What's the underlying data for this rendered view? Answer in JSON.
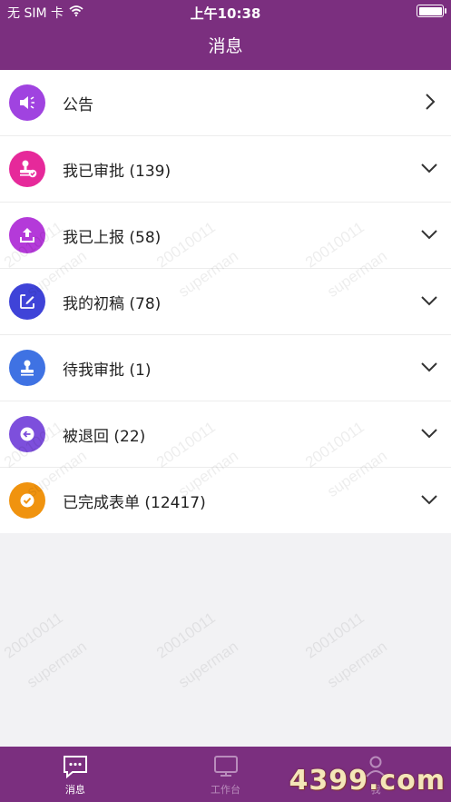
{
  "status_bar": {
    "carrier": "无 SIM 卡",
    "time": "上午10:38"
  },
  "header": {
    "title": "消息"
  },
  "list": [
    {
      "label": "公告",
      "icon": "speaker-icon",
      "color": "#a043e0",
      "chevron": "right"
    },
    {
      "label": "我已审批 (139)",
      "icon": "stamp-approved-icon",
      "color": "#e6299a",
      "chevron": "down"
    },
    {
      "label": "我已上报 (58)",
      "icon": "upload-icon",
      "color": "#b43ad9",
      "chevron": "down"
    },
    {
      "label": "我的初稿 (78)",
      "icon": "edit-draft-icon",
      "color": "#3f43d8",
      "chevron": "down"
    },
    {
      "label": "待我审批 (1)",
      "icon": "stamp-icon",
      "color": "#3f72e3",
      "chevron": "down"
    },
    {
      "label": "被退回 (22)",
      "icon": "return-arrow-icon",
      "color": "#7d4fdc",
      "chevron": "down"
    },
    {
      "label": "已完成表单 (12417)",
      "icon": "check-circle-icon",
      "color": "#f0930f",
      "chevron": "down"
    }
  ],
  "watermark": {
    "line1": "20010011",
    "line2": "superman"
  },
  "tabs": [
    {
      "label": "消息",
      "icon": "chat-icon",
      "active": true
    },
    {
      "label": "工作台",
      "icon": "monitor-icon",
      "active": false
    },
    {
      "label": "我",
      "icon": "person-icon",
      "active": false
    }
  ],
  "brand_logo": "4399.com"
}
